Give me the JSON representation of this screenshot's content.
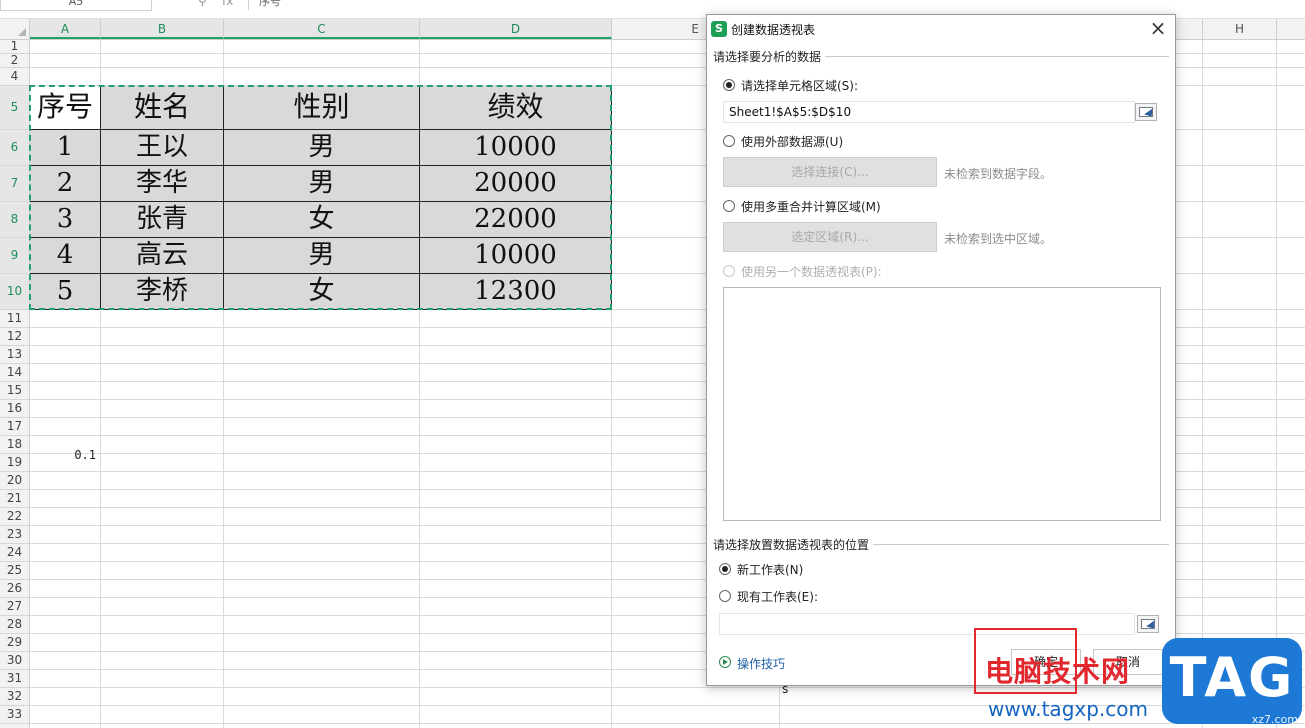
{
  "formula_bar": {
    "name_box": "A5",
    "fx_label": "fx",
    "content": "序号"
  },
  "columns": [
    {
      "label": "A",
      "selected": true
    },
    {
      "label": "B",
      "selected": true
    },
    {
      "label": "C",
      "selected": true
    },
    {
      "label": "D",
      "selected": true
    },
    {
      "label": "E",
      "selected": false
    },
    {
      "label": "H",
      "selected": false
    }
  ],
  "rows": [
    "1",
    "2",
    "4",
    "5",
    "6",
    "7",
    "8",
    "9",
    "10",
    "11",
    "12",
    "13",
    "14",
    "15",
    "16",
    "17",
    "18",
    "19",
    "20",
    "21",
    "22",
    "23",
    "24",
    "25",
    "26",
    "27",
    "28",
    "29",
    "30",
    "31",
    "32",
    "33"
  ],
  "selected_rows": [
    "5",
    "6",
    "7",
    "8",
    "9",
    "10"
  ],
  "table": {
    "headers": [
      "序号",
      "姓名",
      "性别",
      "绩效"
    ],
    "rows": [
      [
        "1",
        "王以",
        "男",
        "10000"
      ],
      [
        "2",
        "李华",
        "男",
        "20000"
      ],
      [
        "3",
        "张青",
        "女",
        "22000"
      ],
      [
        "4",
        "高云",
        "男",
        "10000"
      ],
      [
        "5",
        "李桥",
        "女",
        "12300"
      ]
    ]
  },
  "cells": {
    "a18": "0.1",
    "e31": "s"
  },
  "dialog": {
    "app_icon": "S",
    "title": "创建数据透视表",
    "close_label": "×",
    "section1_title": "请选择要分析的数据",
    "opt_range_label": "请选择单元格区域(S):",
    "range_value": "Sheet1!$A$5:$D$10",
    "opt_external_label": "使用外部数据源(U)",
    "select_connection_label": "选择连接(C)...",
    "no_field_note": "未检索到数据字段。",
    "opt_multi_label": "使用多重合并计算区域(M)",
    "select_region_label": "选定区域(R)...",
    "no_region_note": "未检索到选中区域。",
    "opt_other_pivot_label": "使用另一个数据透视表(P):",
    "section2_title": "请选择放置数据透视表的位置",
    "opt_new_sheet_label": "新工作表(N)",
    "opt_existing_sheet_label": "现有工作表(E):",
    "existing_value": "",
    "tips_label": "操作技巧",
    "ok_label": "确定",
    "cancel_label": "取消"
  },
  "watermark": {
    "site_name": "电脑技术网",
    "url": "www.tagxp.com",
    "tag": "TAG",
    "tag_sub": "xz7.com"
  },
  "colors": {
    "selection": "#22a06b",
    "table_fill": "#d9d9d9",
    "accent_red": "#e0282e",
    "tag_blue": "#1d78d6"
  }
}
